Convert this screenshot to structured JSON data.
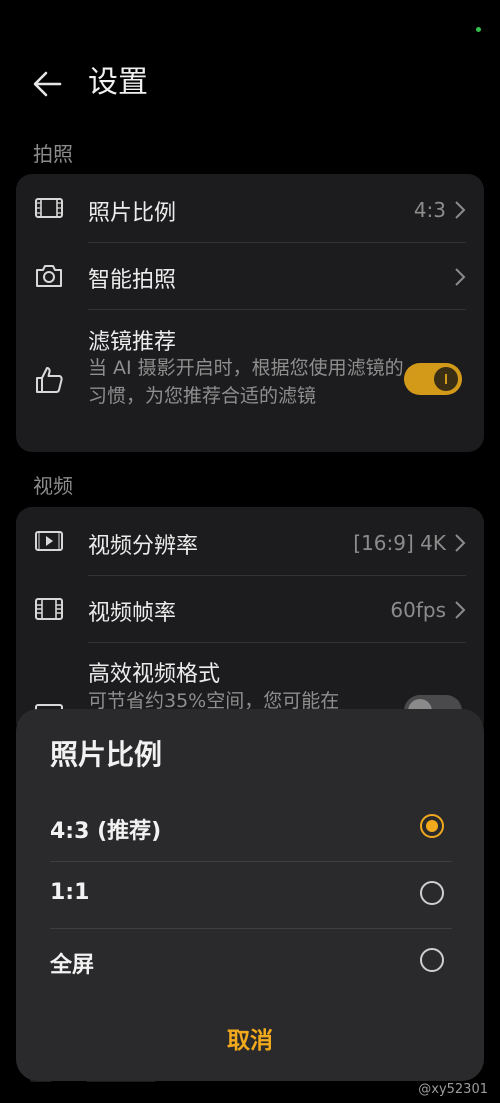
{
  "header": {
    "title": "设置"
  },
  "sections": {
    "photo": {
      "label": "拍照"
    },
    "video": {
      "label": "视频"
    }
  },
  "photo_rows": {
    "ratio": {
      "label": "照片比例",
      "value": "4:3",
      "icon": "aspect-ratio-icon"
    },
    "smart": {
      "label": "智能拍照",
      "icon": "camera-icon"
    },
    "filter": {
      "label": "滤镜推荐",
      "desc": "当 AI 摄影开启时，根据您使用滤镜的习惯，为您推荐合适的滤镜",
      "enabled": true,
      "icon": "thumbs-up-icon"
    }
  },
  "video_rows": {
    "resolution": {
      "label": "视频分辨率",
      "value": "[16:9] 4K",
      "icon": "video-play-icon"
    },
    "framerate": {
      "label": "视频帧率",
      "value": "60fps",
      "icon": "film-icon"
    },
    "hevc": {
      "label": "高效视频格式",
      "desc": "可节省约35%空间，您可能在",
      "enabled": false,
      "icon": "file-format-icon"
    }
  },
  "sheet": {
    "title": "照片比例",
    "options": [
      {
        "label": "4:3 (推荐)",
        "selected": true
      },
      {
        "label": "1:1",
        "selected": false
      },
      {
        "label": "全屏",
        "selected": false
      }
    ],
    "cancel_label": "取消"
  },
  "watermark": "@xy52301",
  "colors": {
    "accent": "#f2a91c",
    "toggle_on": "#d39a1a",
    "card": "#1c1c1e",
    "sheet": "#2a2a2c"
  }
}
